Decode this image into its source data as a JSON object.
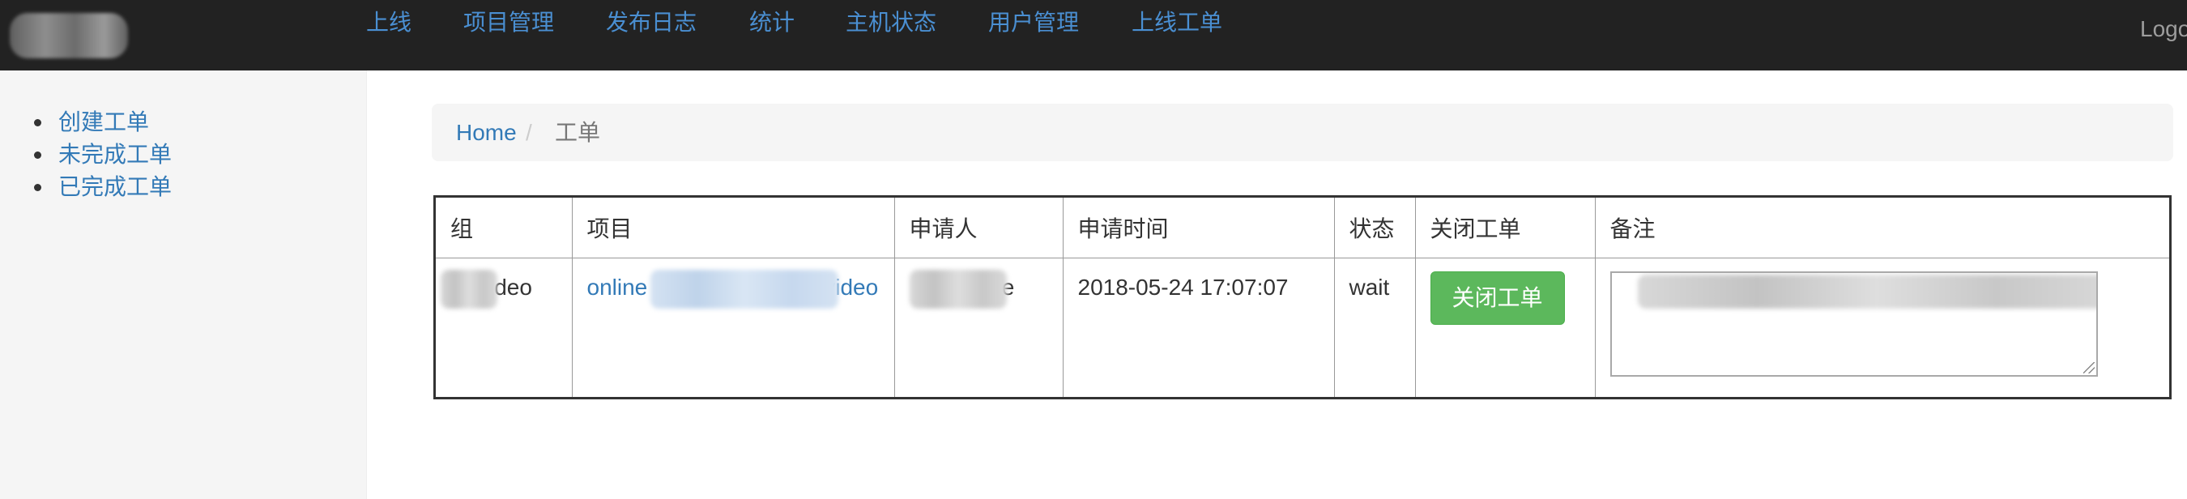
{
  "navbar": {
    "items": [
      {
        "label": "上线"
      },
      {
        "label": "项目管理"
      },
      {
        "label": "发布日志"
      },
      {
        "label": "统计"
      },
      {
        "label": "主机状态"
      },
      {
        "label": "用户管理"
      },
      {
        "label": "上线工单"
      }
    ],
    "logout_label": "Logout"
  },
  "sidebar": {
    "items": [
      {
        "label": "创建工单"
      },
      {
        "label": "未完成工单"
      },
      {
        "label": "已完成工单"
      }
    ]
  },
  "breadcrumb": {
    "home": "Home",
    "separator": "/",
    "current": "工单"
  },
  "table": {
    "headers": [
      "组",
      "项目",
      "申请人",
      "申请时间",
      "状态",
      "关闭工单",
      "备注"
    ],
    "rows": [
      {
        "group": "ideo",
        "project_prefix": "online",
        "project_suffix": "video",
        "applicant": "ie",
        "time": "2018-05-24 17:07:07",
        "status": "wait",
        "close_label": "关闭工单"
      }
    ]
  },
  "colors": {
    "navbar_bg": "#222222",
    "nav_link": "#4a8fd2",
    "link": "#337ab7",
    "success_button": "#5cb85c"
  }
}
